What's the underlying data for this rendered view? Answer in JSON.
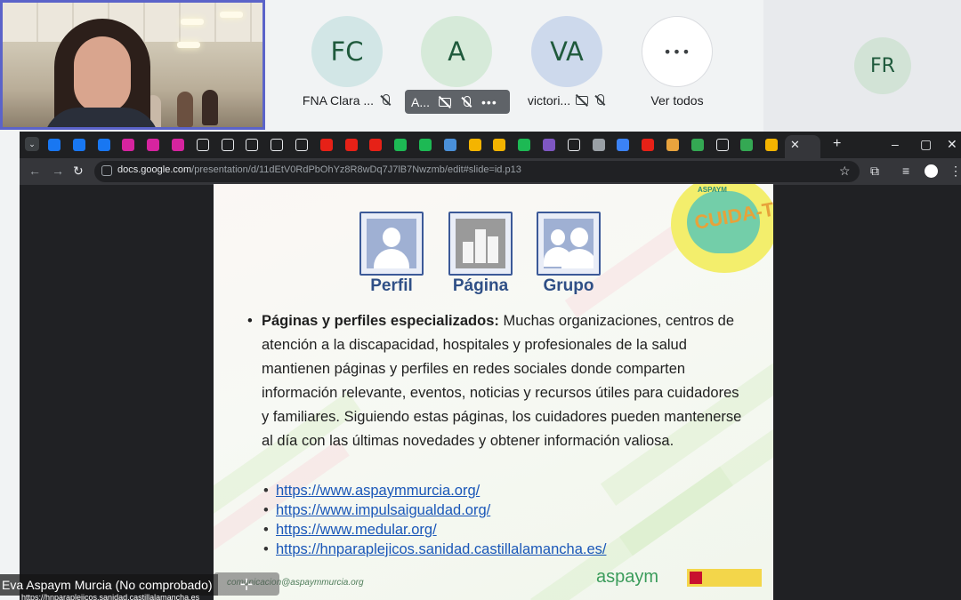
{
  "meeting": {
    "participants": [
      {
        "initials": "FC",
        "name": "FNA Clara ...",
        "avatar_color": "#d2e6e6"
      },
      {
        "initials": "A",
        "name": "A...",
        "avatar_color": "#d6ead9"
      },
      {
        "initials": "VA",
        "name": "victori...",
        "avatar_color": "#cdd9ec"
      },
      {
        "initials": "•••",
        "name": "Ver todos",
        "avatar_color": "#ffffff"
      }
    ],
    "side_participant": {
      "initials": "FR"
    },
    "presenter_name": "Eva Aspaym Murcia (No comprobado)",
    "caption_url": "https://hnparaplejicos.sanidad.castillalamancha.es"
  },
  "browser": {
    "url_host": "docs.google.com",
    "url_path": "/presentation/d/11dEtV0RdPbOhYz8R8wDq7J7lB7Nwzmb/edit#slide=id.p13"
  },
  "slide": {
    "icons": [
      {
        "label": "Perfil"
      },
      {
        "label": "Página"
      },
      {
        "label": "Grupo"
      }
    ],
    "logo_text": "CUIDA-TE",
    "logo_small": "ASPAYM",
    "bullet_bold": "Páginas y perfiles especializados:",
    "bullet_text": " Muchas organizaciones, centros de atención a la discapacidad, hospitales y profesionales de la salud mantienen páginas y perfiles en redes sociales donde comparten información relevante, eventos, noticias y recursos útiles para cuidadores y familiares. Siguiendo estas páginas, los cuidadores pueden mantenerse al día con las últimas novedades y obtener información valiosa.",
    "links": [
      "https://www.aspaymmurcia.org/",
      "https://www.impulsaigualdad.org/",
      "https://www.medular.org/",
      "https://hnparaplejicos.sanidad.castillalamancha.es/"
    ],
    "footer_email": "comunicacion@aspaymmurcia.org",
    "footer_logo": "aspaym"
  },
  "colors": {
    "self_video_border": "#5b63c9",
    "link": "#1a57b8",
    "fb_blue": "#3b5998"
  }
}
